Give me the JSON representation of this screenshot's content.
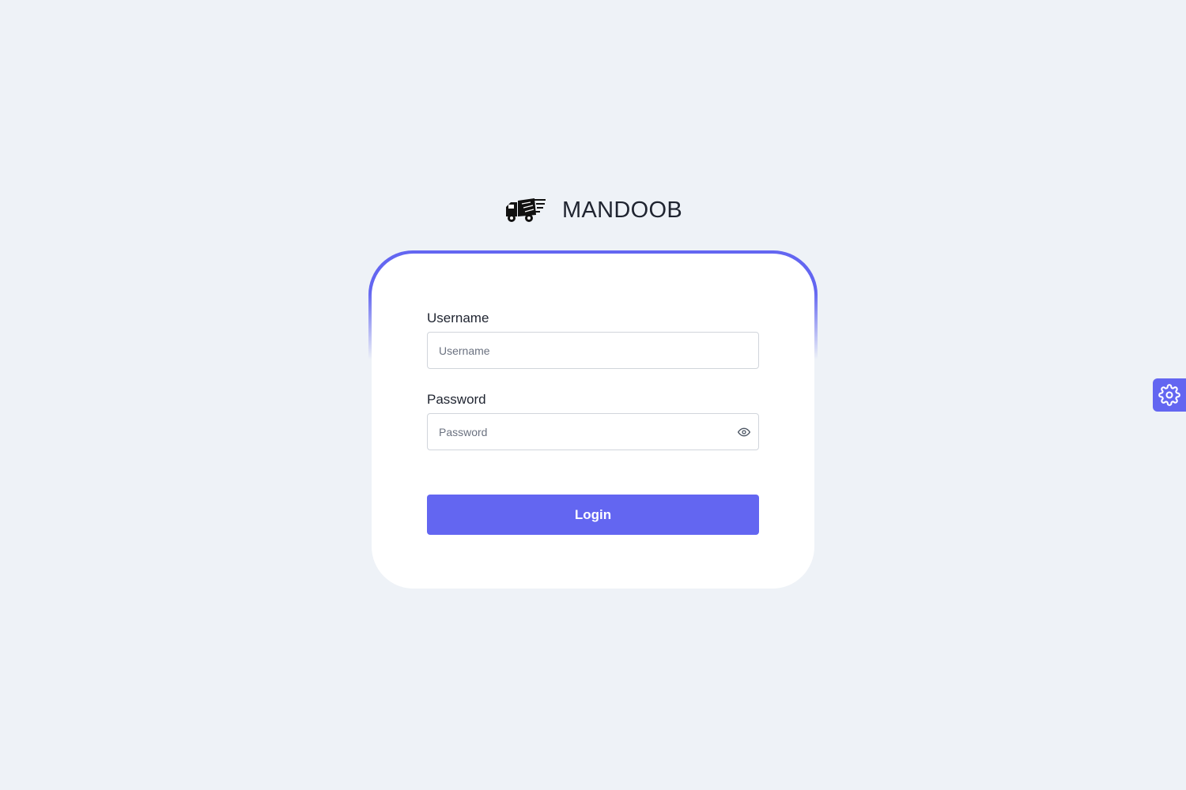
{
  "brand": {
    "name": "MANDOOB",
    "logo_icon": "delivery-truck-icon"
  },
  "form": {
    "username": {
      "label": "Username",
      "placeholder": "Username",
      "value": ""
    },
    "password": {
      "label": "Password",
      "placeholder": "Password",
      "value": "",
      "toggle_icon": "eye-icon"
    },
    "submit_label": "Login"
  },
  "settings": {
    "icon": "gear-icon"
  },
  "colors": {
    "accent": "#6366f1",
    "background": "#eef2f7",
    "card": "#ffffff",
    "text": "#1f2430"
  }
}
